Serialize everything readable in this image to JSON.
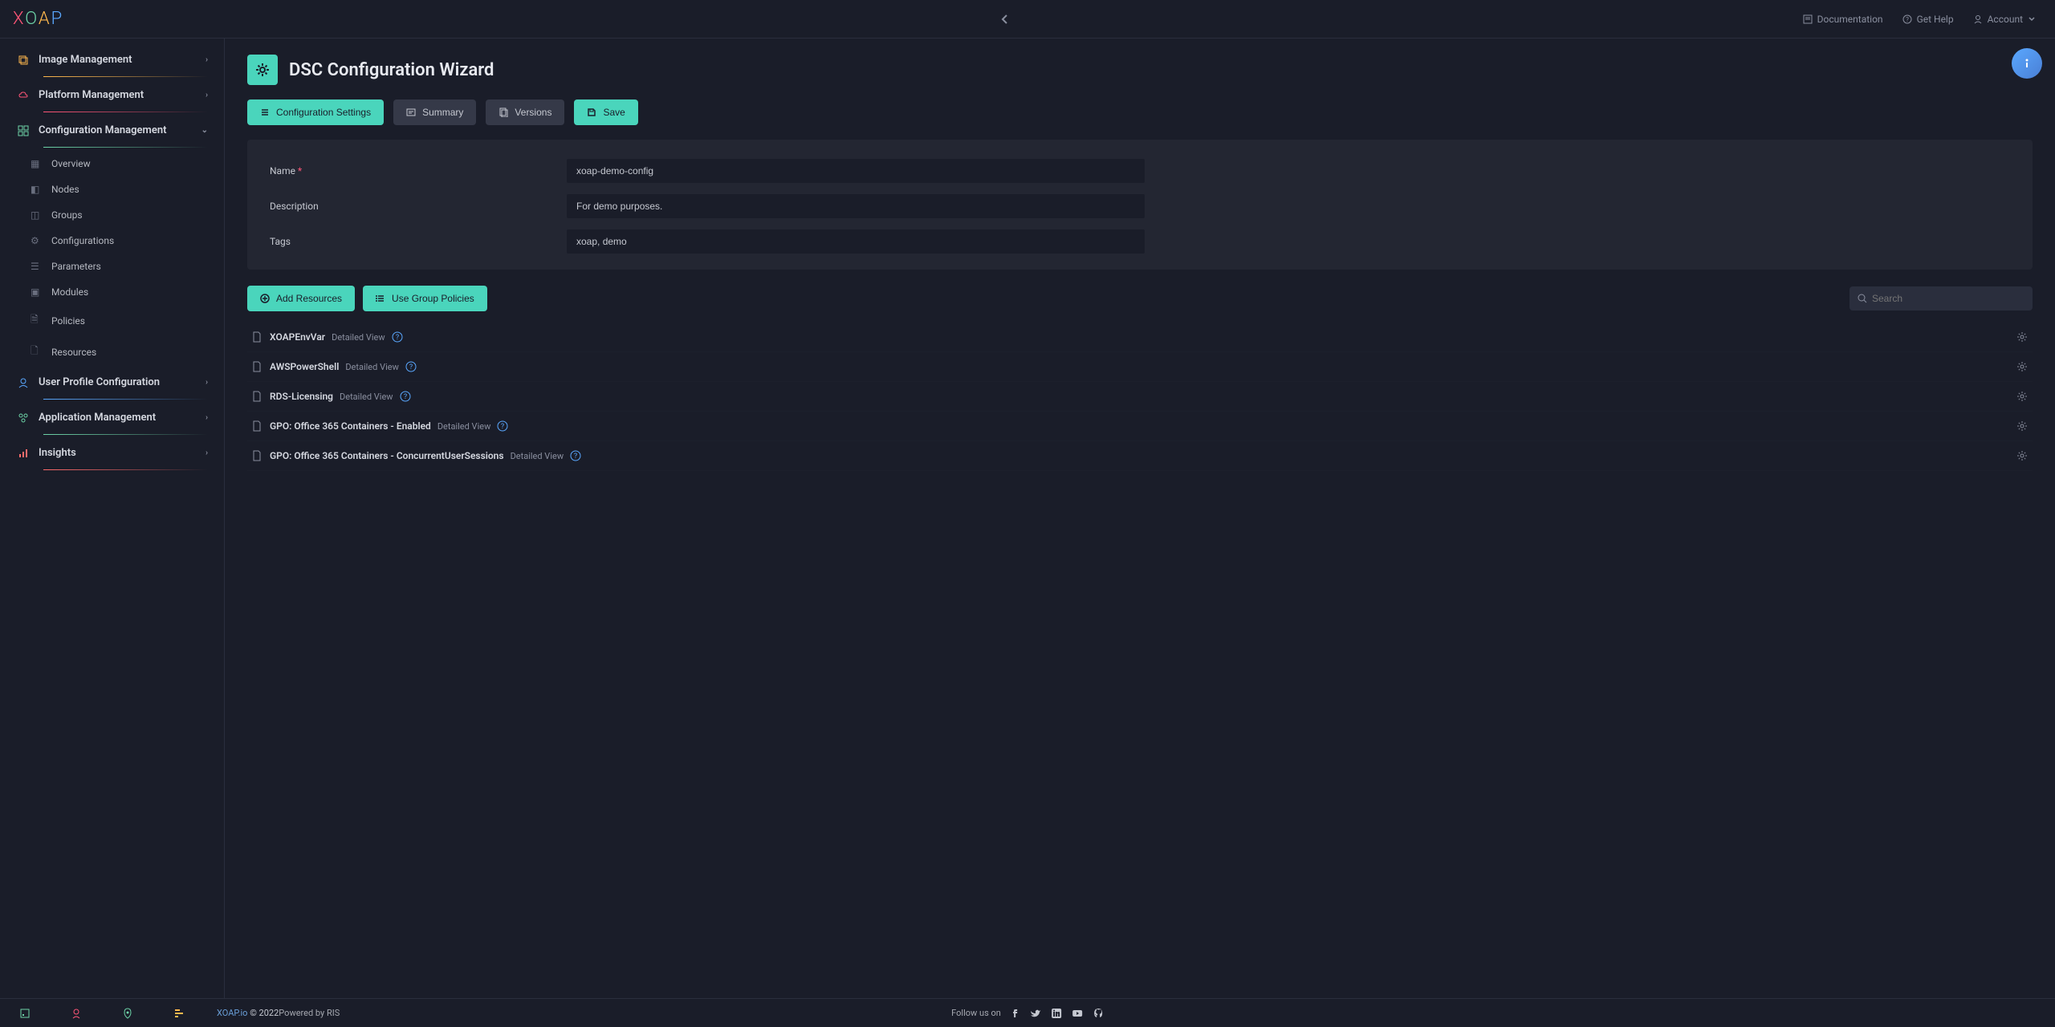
{
  "topbar": {
    "doc": "Documentation",
    "help": "Get Help",
    "account": "Account"
  },
  "sidebar": {
    "top": [
      {
        "label": "Image Management",
        "color": "orange"
      },
      {
        "label": "Platform Management",
        "color": "pink"
      },
      {
        "label": "Configuration Management",
        "color": "green",
        "expanded": true
      }
    ],
    "sub": [
      "Overview",
      "Nodes",
      "Groups",
      "Configurations",
      "Parameters",
      "Modules",
      "Policies",
      "Resources"
    ],
    "bottom": [
      {
        "label": "User Profile Configuration",
        "color": "blue"
      },
      {
        "label": "Application Management",
        "color": "green"
      },
      {
        "label": "Insights",
        "color": "red"
      }
    ]
  },
  "page": {
    "title": "DSC Configuration Wizard",
    "toolbar": {
      "config_settings": "Configuration Settings",
      "summary": "Summary",
      "versions": "Versions",
      "save": "Save"
    },
    "form": {
      "name_label": "Name",
      "name_value": "xoap-demo-config",
      "desc_label": "Description",
      "desc_value": "For demo purposes.",
      "tags_label": "Tags",
      "tags_value": "xoap, demo"
    },
    "actions": {
      "add_resources": "Add Resources",
      "use_group": "Use Group Policies",
      "search_placeholder": "Search"
    },
    "detailed_view": "Detailed View",
    "resources": [
      "XOAPEnvVar",
      "AWSPowerShell",
      "RDS-Licensing",
      "GPO: Office 365 Containers - Enabled",
      "GPO: Office 365 Containers - ConcurrentUserSessions"
    ]
  },
  "footer": {
    "link": "XOAP.io",
    "copyright": "© 2022",
    "follow": "Follow us on",
    "powered": "Powered by RIS"
  }
}
